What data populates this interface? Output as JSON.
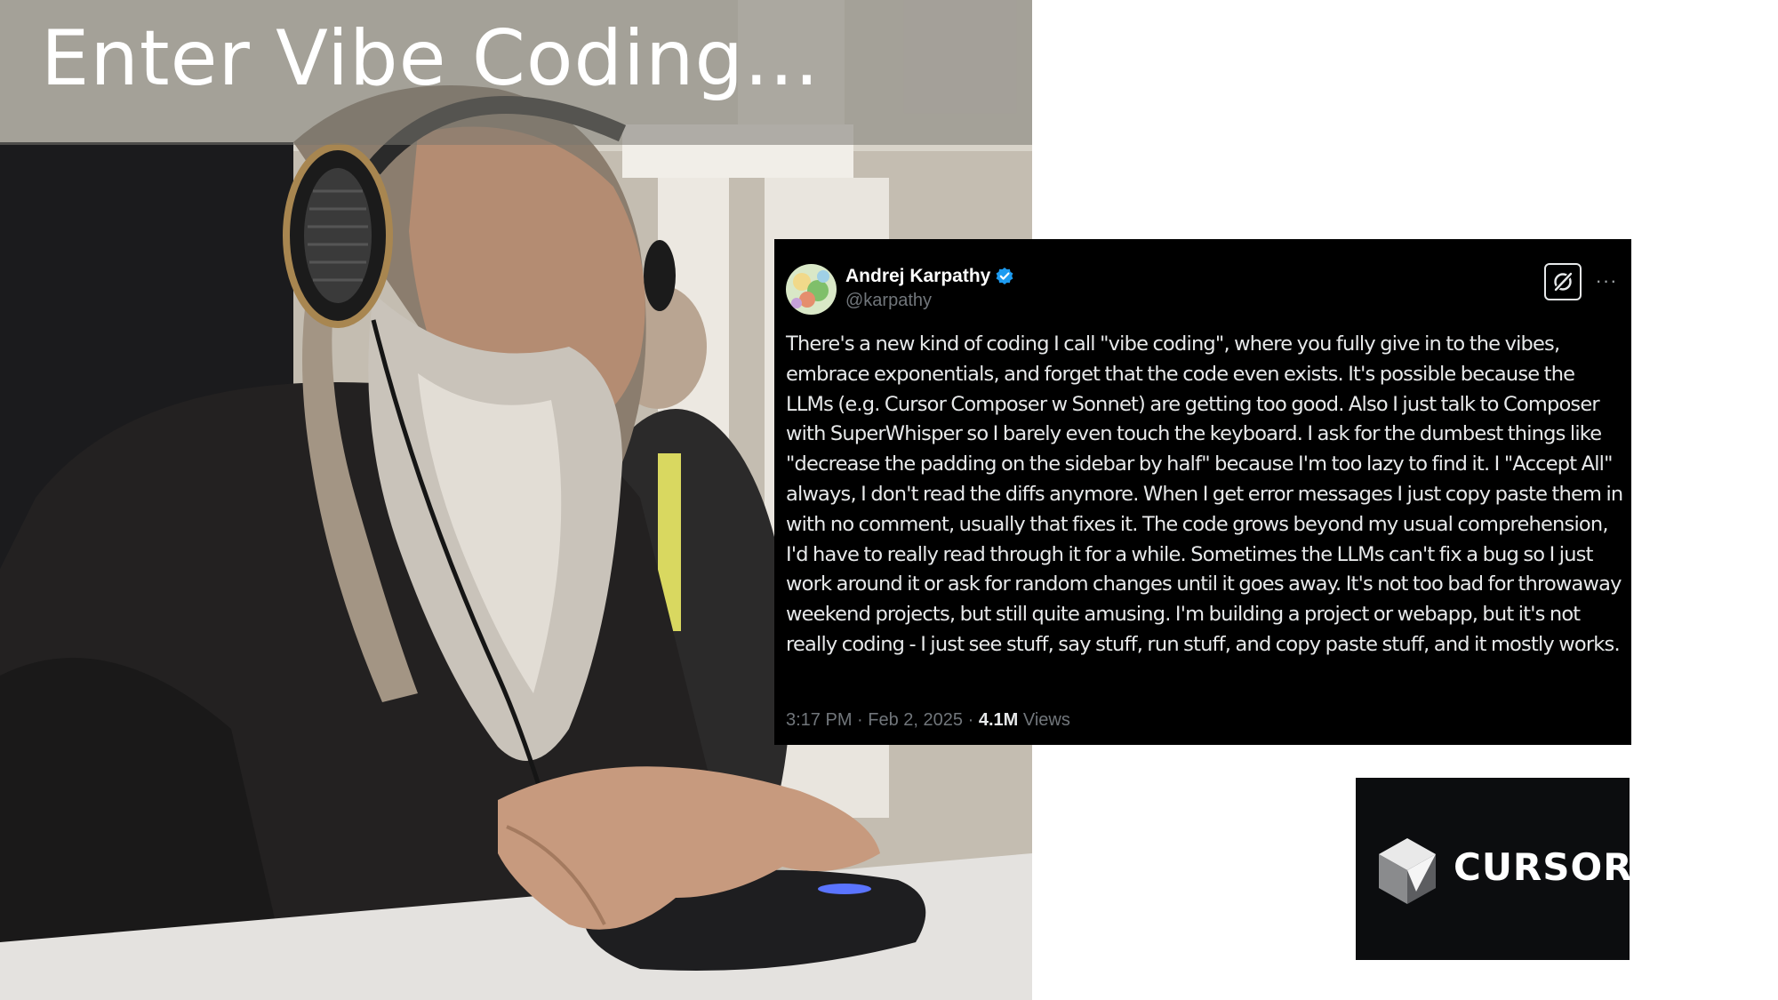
{
  "slide": {
    "title": "Enter Vibe Coding..."
  },
  "photo": {
    "icon": "person-with-headphones-photo"
  },
  "tweet": {
    "author_name": "Andrej Karpathy",
    "handle": "@karpathy",
    "verified_icon": "verified-badge-icon",
    "grok_icon": "grok-icon",
    "more_label": "···",
    "text": "There's a new kind of coding I call \"vibe coding\", where you fully give in to the vibes, embrace exponentials, and forget that the code even exists. It's possible because the LLMs (e.g. Cursor Composer w Sonnet) are getting too good. Also I just talk to Composer with SuperWhisper so I barely even touch the keyboard. I ask for the dumbest things like \"decrease the padding on the sidebar by half\" because I'm too lazy to find it. I \"Accept All\" always, I don't read the diffs anymore. When I get error messages I just copy paste them in with no comment, usually that fixes it. The code grows beyond my usual comprehension, I'd have to really read through it for a while. Sometimes the LLMs can't fix a bug so I just work around it or ask for random changes until it goes away. It's not too bad for throwaway weekend projects, but still quite amusing. I'm building a project or webapp, but it's not really coding - I just see stuff, say stuff, run stuff, and copy paste stuff, and it mostly works.",
    "time": "3:17 PM",
    "separator": "·",
    "date": "Feb 2, 2025",
    "views_count": "4.1M",
    "views_label": "Views",
    "colors": {
      "background": "#000000",
      "text": "#e7e9ea",
      "muted": "#71767b",
      "verified": "#1d9bf0"
    }
  },
  "logo": {
    "wordmark": "CURSOR",
    "icon": "cursor-cube-logo-icon",
    "background": "#0c0d0f"
  }
}
